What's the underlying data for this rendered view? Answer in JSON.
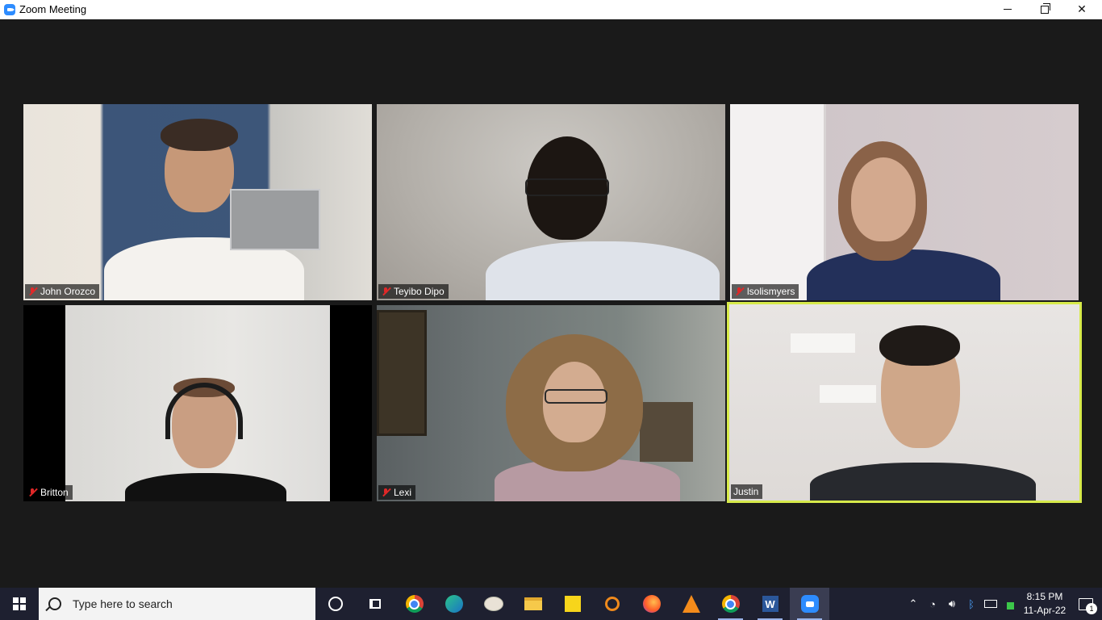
{
  "window": {
    "title": "Zoom Meeting"
  },
  "participants": [
    {
      "name": "John Orozco",
      "muted": true
    },
    {
      "name": "Teyibo Dipo",
      "muted": true
    },
    {
      "name": "lsolismyers",
      "muted": true
    },
    {
      "name": "Britton",
      "muted": true
    },
    {
      "name": "Lexi",
      "muted": true
    },
    {
      "name": "Justin",
      "muted": false,
      "active_speaker": true
    }
  ],
  "colors": {
    "active_speaker_border": "#d7ea4a",
    "muted_icon": "#e02828",
    "taskbar": "#1e2030"
  },
  "taskbar": {
    "search_placeholder": "Type here to search",
    "apps": [
      "cortana-icon",
      "task-view-icon",
      "chrome-icon",
      "edge-icon",
      "paint-icon",
      "file-explorer-icon",
      "sticky-notes-icon",
      "search-app-icon",
      "firefox-icon",
      "vlc-icon",
      "chrome-canary-icon",
      "word-icon",
      "zoom-icon"
    ],
    "time": "8:15 PM",
    "date": "11-Apr-22",
    "notification_count": "1"
  }
}
